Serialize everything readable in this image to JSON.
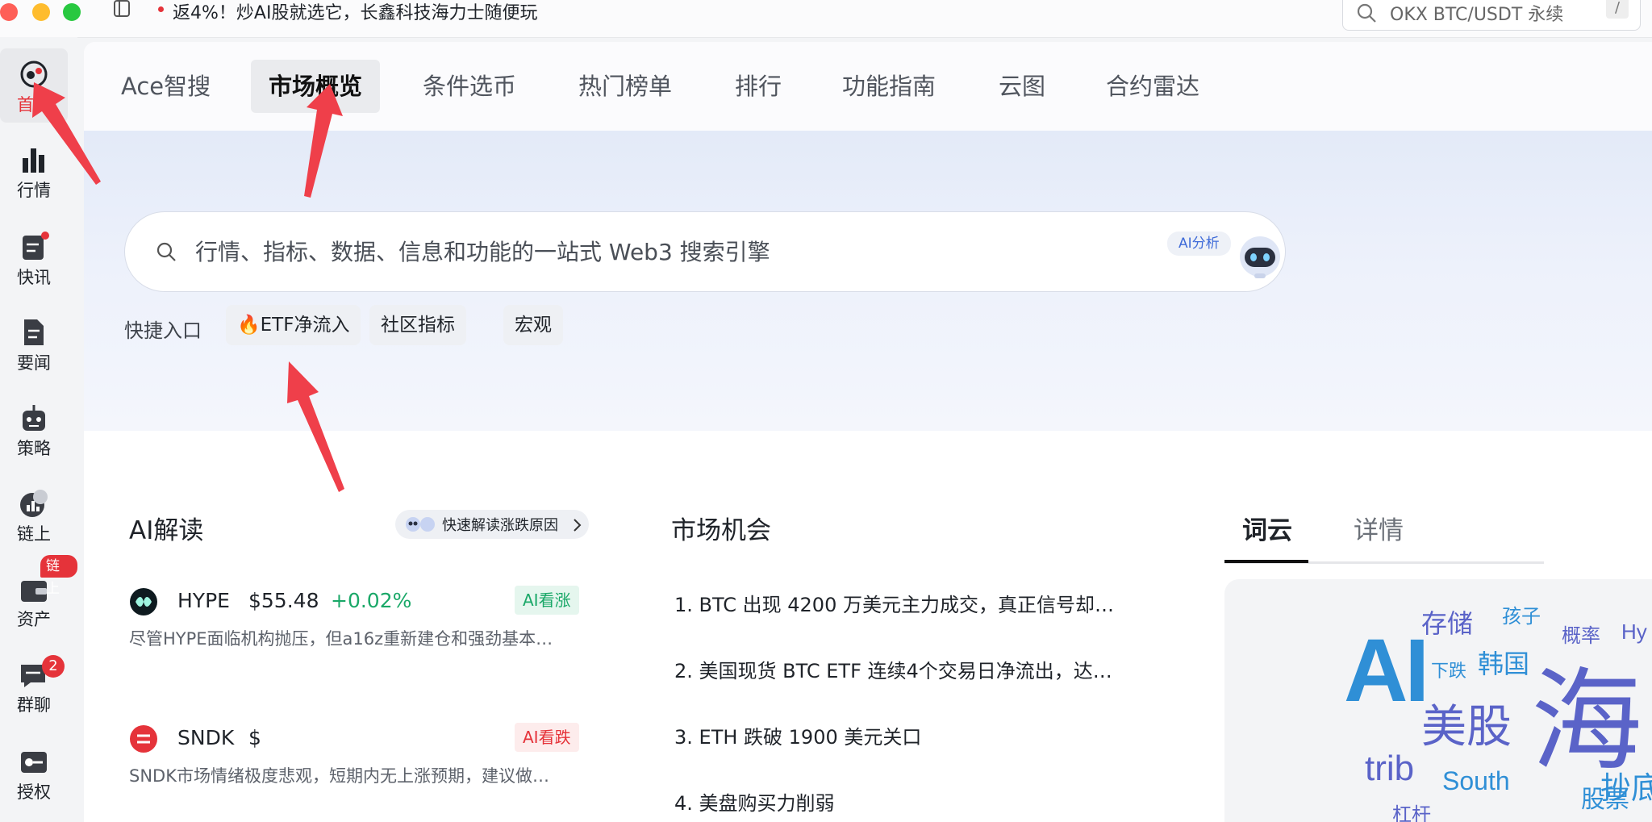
{
  "titlebar": {
    "promo_text": "返4%！炒AI股就选它，长鑫科技海力士随便玩",
    "search_placeholder": "OKX BTC/USDT 永续",
    "search_shortcut": "/"
  },
  "sidebar": {
    "items": [
      {
        "label": "首页",
        "icon": "home-logo-icon",
        "active": true
      },
      {
        "label": "行情",
        "icon": "bar-chart-icon"
      },
      {
        "label": "快讯",
        "icon": "flash-news-icon"
      },
      {
        "label": "要闻",
        "icon": "document-icon"
      },
      {
        "label": "策略",
        "icon": "robot-icon"
      },
      {
        "label": "链上",
        "icon": "chain-chart-icon"
      },
      {
        "label": "资产",
        "icon": "wallet-icon",
        "badge": "链上"
      },
      {
        "label": "群聊",
        "icon": "chat-icon",
        "badge": "2"
      },
      {
        "label": "授权",
        "icon": "key-icon"
      }
    ]
  },
  "tabs": [
    {
      "label": "Ace智搜"
    },
    {
      "label": "市场概览",
      "active": true
    },
    {
      "label": "条件选币"
    },
    {
      "label": "热门榜单"
    },
    {
      "label": "排行"
    },
    {
      "label": "功能指南"
    },
    {
      "label": "云图"
    },
    {
      "label": "合约雷达"
    }
  ],
  "search": {
    "placeholder": "行情、指标、数据、信息和功能的一站式 Web3 搜索引擎",
    "ai_badge": "AI分析"
  },
  "quick": {
    "label": "快捷入口",
    "chips": [
      "🔥ETF净流入",
      "社区指标",
      "宏观"
    ]
  },
  "ai_read": {
    "title": "AI解读",
    "fast_btn": "快速解读涨跌原因",
    "items": [
      {
        "symbol": "HYPE",
        "price": "$55.48",
        "change": "+0.02%",
        "tag": "AI看涨",
        "summary": "尽管HYPE面临机构抛压，但a16z重新建仓和强劲基本…"
      },
      {
        "symbol": "SNDK",
        "price": "$",
        "change": "",
        "tag": "AI看跌",
        "summary": "SNDK市场情绪极度悲观，短期内无上涨预期，建议做…"
      }
    ]
  },
  "market": {
    "title": "市场机会",
    "items": [
      "1.  BTC 出现 4200 万美元主力成交，真正信号却…",
      "2.  美国现货 BTC ETF 连续4个交易日净流出，达…",
      "3.  ETH 跌破 1900 美元关口",
      "4.  美盘购买力削弱"
    ]
  },
  "cloud_tabs": [
    {
      "label": "词云",
      "active": true
    },
    {
      "label": "详情"
    }
  ],
  "word_cloud": {
    "words": [
      "存储",
      "孩子",
      "概率",
      "Hy",
      "下跌",
      "韩国",
      "AI",
      "海",
      "美股",
      "trib",
      "South",
      "抄底",
      "股票",
      "杠杆"
    ]
  },
  "colors": {
    "accent": "#e5333a",
    "up": "#1aa868",
    "down": "#e5333a",
    "cloud_blue": "#2f8fd6",
    "cloud_indigo": "#5a63c8"
  }
}
